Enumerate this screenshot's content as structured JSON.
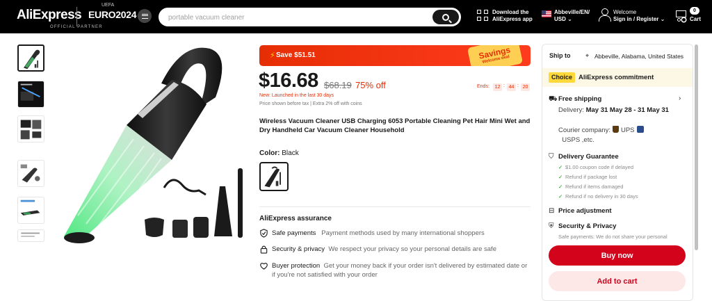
{
  "header": {
    "logo": "AliExpress",
    "partner_brand": "EURO2024",
    "partner_crest": "UEFA",
    "partner_tagline": "OFFICIAL PARTNER",
    "search_placeholder": "portable vacuum cleaner",
    "app_line1": "Download the",
    "app_line2": "AliExpress app",
    "locale_line1": "Abbeville/EN/",
    "locale_line2": "USD",
    "welcome_line1": "Welcome",
    "welcome_line2": "Sign in / Register",
    "cart_count": "0",
    "cart_label": "Cart"
  },
  "gallery": {
    "thumb_count": 6,
    "active_index": 0
  },
  "product": {
    "save_text": "Save $51.51",
    "savings_tag_line1": "Savings",
    "savings_tag_line2": "Welcome deal",
    "price": "$16.68",
    "original_price": "$68.19",
    "discount": "75% off",
    "new_launch": "New: Launched in the last 30 days",
    "tax_note": "Price shown before tax  |  Extra 2% off with coins",
    "ends_label": "Ends:",
    "countdown": [
      "12",
      "44",
      "20"
    ],
    "title": "Wireless Vacuum Cleaner USB Charging 6053 Portable Cleaning Pet Hair Mini Wet and Dry Handheld Car Vacuum Cleaner Household",
    "color_label": "Color:",
    "color_value": "Black",
    "assurance_title": "AliExpress assurance",
    "assurance": [
      {
        "key": "Safe payments",
        "value": "Payment methods used by many international shoppers"
      },
      {
        "key": "Security & privacy",
        "value": "We respect your privacy so your personal details are safe"
      },
      {
        "key": "Buyer protection",
        "value": "Get your money back if your order isn't delivered by estimated date or if you're not satisfied with your order"
      }
    ]
  },
  "panel": {
    "ship_to_label": "Ship to",
    "ship_to_value": "Abbeville, Alabama, United States",
    "choice_badge": "Choice",
    "commitment": "AliExpress commitment",
    "free_shipping": "Free shipping",
    "delivery_prefix": "Delivery:",
    "delivery_dates": "May 31 May 28 - 31 May 31",
    "courier_prefix": "Courier company:",
    "courier_ups": "UPS",
    "courier_usps": "USPS ,etc.",
    "guarantee_title": "Delivery Guarantee",
    "guarantee_items": [
      "$1.00 coupon code if delayed",
      "Refund if package lost",
      "Refund if items damaged",
      "Refund if no delivery in 30 days"
    ],
    "price_adjustment": "Price adjustment",
    "security_title": "Security & Privacy",
    "security_sub": "Safe payments: We do not share your personal",
    "buy_now": "Buy now",
    "add_to_cart": "Add to cart"
  },
  "colors": {
    "brand_red": "#d3031c",
    "sale_red": "#e62e04",
    "choice_yellow": "#ffd83a",
    "header_bg": "#000000"
  }
}
